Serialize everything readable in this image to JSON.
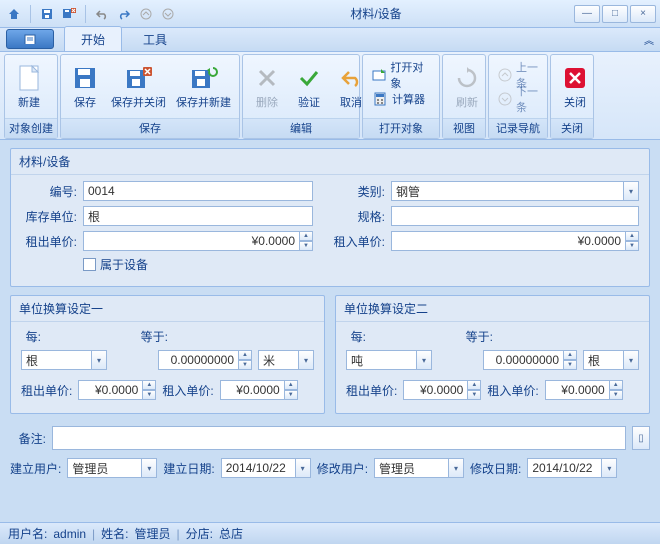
{
  "window": {
    "title": "材料/设备"
  },
  "tabs": {
    "start": "开始",
    "tools": "工具"
  },
  "ribbon": {
    "group_create": "对象创建",
    "group_save": "保存",
    "group_edit": "编辑",
    "group_open": "打开对象",
    "group_view": "视图",
    "group_nav": "记录导航",
    "group_close": "关闭",
    "new": "新建",
    "save": "保存",
    "save_close": "保存并关闭",
    "save_new": "保存并新建",
    "delete": "删除",
    "validate": "验证",
    "cancel": "取消",
    "open_obj": "打开对象",
    "calculator": "计算器",
    "refresh": "刷新",
    "prev": "上一条",
    "next": "下一条",
    "close": "关闭"
  },
  "main_panel": {
    "title": "材料/设备",
    "code_label": "编号:",
    "code": "0014",
    "category_label": "类别:",
    "category": "钢管",
    "stock_unit_label": "库存单位:",
    "stock_unit": "根",
    "spec_label": "规格:",
    "spec": "",
    "rent_out_label": "租出单价:",
    "rent_out": "¥0.0000",
    "rent_in_label": "租入单价:",
    "rent_in": "¥0.0000",
    "is_equipment_label": "属于设备"
  },
  "unit1": {
    "title": "单位换算设定一",
    "per_label": "每:",
    "per_unit": "根",
    "equal_label": "等于:",
    "equal_val": "0.00000000",
    "equal_unit": "米",
    "rent_out_label": "租出单价:",
    "rent_out": "¥0.0000",
    "rent_in_label": "租入单价:",
    "rent_in": "¥0.0000"
  },
  "unit2": {
    "title": "单位换算设定二",
    "per_label": "每:",
    "per_unit": "吨",
    "equal_label": "等于:",
    "equal_val": "0.00000000",
    "equal_unit": "根",
    "rent_out_label": "租出单价:",
    "rent_out": "¥0.0000",
    "rent_in_label": "租入单价:",
    "rent_in": "¥0.0000"
  },
  "remark_label": "备注:",
  "audit": {
    "create_user_label": "建立用户:",
    "create_user": "管理员",
    "create_date_label": "建立日期:",
    "create_date": "2014/10/22",
    "modify_user_label": "修改用户:",
    "modify_user": "管理员",
    "modify_date_label": "修改日期:",
    "modify_date": "2014/10/22"
  },
  "status": {
    "user_label": "用户名:",
    "user": "admin",
    "name_label": "姓名:",
    "name": "管理员",
    "branch_label": "分店:",
    "branch": "总店"
  }
}
